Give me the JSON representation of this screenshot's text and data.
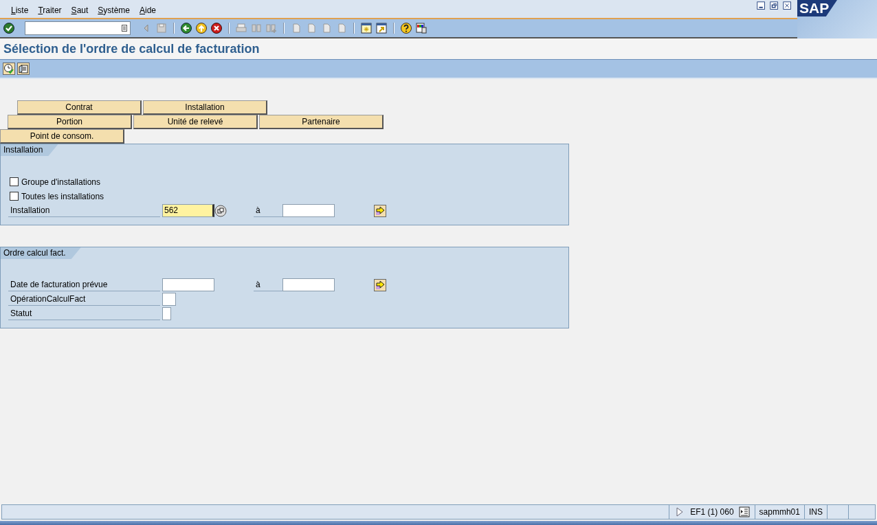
{
  "menu": [
    "Liste",
    "Traiter",
    "Saut",
    "Système",
    "Aide"
  ],
  "logo": "SAP",
  "title": "Sélection de l'ordre de calcul de facturation",
  "selection_buttons": [
    [
      "Contrat",
      "Installation"
    ],
    [
      "Portion",
      "Unité de relevé",
      "Partenaire"
    ],
    [
      "Point de consom."
    ]
  ],
  "groups": [
    {
      "title": "Installation",
      "rows": [
        {
          "kind": "checkbox",
          "label": "Groupe d'installations",
          "checked": false
        },
        {
          "kind": "checkbox",
          "label": "Toutes les installations",
          "checked": false
        },
        {
          "kind": "range",
          "label": "Installation",
          "from": "562",
          "focused": true,
          "to_label": "à",
          "to": ""
        }
      ]
    },
    {
      "title": "Ordre calcul fact.",
      "rows": [
        {
          "kind": "range",
          "label": "Date de facturation prévue",
          "from": "",
          "focused": false,
          "to_label": "à",
          "to": ""
        },
        {
          "kind": "short",
          "label": "OpérationCalculFact",
          "value": ""
        },
        {
          "kind": "char",
          "label": "Statut",
          "value": ""
        }
      ]
    }
  ],
  "status_bar": {
    "system": "EF1 (1) 060",
    "server": "sapmmh01",
    "mode": "INS"
  }
}
